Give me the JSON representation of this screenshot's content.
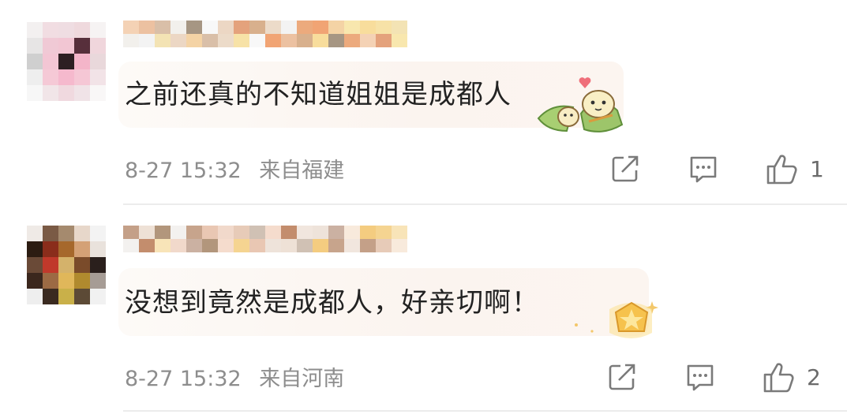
{
  "comments": [
    {
      "text": "之前还真的不知道姐姐是成都人",
      "date": "8-27 15:32",
      "location": "来自福建",
      "likes": "1",
      "sticker_icon": "zongzi-sticker-icon",
      "avatar_colors": [
        [
          "#f3f0f0",
          "#f1dde2",
          "#efdde2",
          "#efd9dd",
          "#f6f3f3"
        ],
        [
          "#e7e5e5",
          "#f0c9d5",
          "#f2c6d3",
          "#572f3b",
          "#f0d6dc"
        ],
        [
          "#cfcfcf",
          "#f3c6d4",
          "#2d1f22",
          "#f4b5c9",
          "#e9d8db"
        ],
        [
          "#eeeeee",
          "#f5c9d6",
          "#f5b9cd",
          "#f5c7d5",
          "#f2e3e7"
        ],
        [
          "#f7f7f7",
          "#f1e5e8",
          "#f0d9df",
          "#f0e3e7",
          "#f9f7f7"
        ]
      ],
      "username_colors": [
        "#f4d2b5",
        "#ecc1a1",
        "#d9bfa8",
        "#f2f0ec",
        "#a69683",
        "#f8f8f8",
        "#ecd7c4",
        "#e4a27c",
        "#d8b08d",
        "#ecdbc9",
        "#f3f3f3",
        "#ecaa7d",
        "#f1a474",
        "#f4d3a5",
        "#f8e7ae",
        "#f8dd9c",
        "#f7e2a7",
        "#f3e3b4"
      ]
    },
    {
      "text": "没想到竟然是成都人，好亲切啊！",
      "date": "8-27 15:32",
      "location": "来自河南",
      "likes": "2",
      "sticker_icon": "gold-star-badge-icon",
      "avatar_colors": [
        [
          "#efeae6",
          "#7a5a45",
          "#a58a6e",
          "#e7d7ca",
          "#f3f3f3"
        ],
        [
          "#2c1c12",
          "#8a2d1b",
          "#a6682c",
          "#d4a176",
          "#e9e2dc"
        ],
        [
          "#6a4a37",
          "#c0392b",
          "#d4b26b",
          "#7a4b2a",
          "#2a1f1c"
        ],
        [
          "#3b271d",
          "#9c6a44",
          "#e0b75a",
          "#b08a2e",
          "#a69c95"
        ],
        [
          "#eee",
          "#3a2a20",
          "#c9b049",
          "#5c4a36",
          "#f1f1f1"
        ]
      ],
      "username_colors": [
        "#c4a088",
        "#eee1d6",
        "#b2967c",
        "#f3f1ef",
        "#c7a48c",
        "#e9c7b3",
        "#f1d9cb",
        "#e7cbb8",
        "#d0c1b4",
        "#f5dccd",
        "#c38d6d",
        "#f1e6de",
        "#eee3da",
        "#cbb1a2",
        "#f8eadc",
        "#f4cc80",
        "#f5d491",
        "#f8e4b8"
      ]
    }
  ],
  "icons": {
    "share": "share-icon",
    "reply": "comment-icon",
    "like": "thumbs-up-icon"
  },
  "colors": {
    "meta_text": "#8d8d8d",
    "icon": "#7a7a7a",
    "divider": "#ececec"
  }
}
